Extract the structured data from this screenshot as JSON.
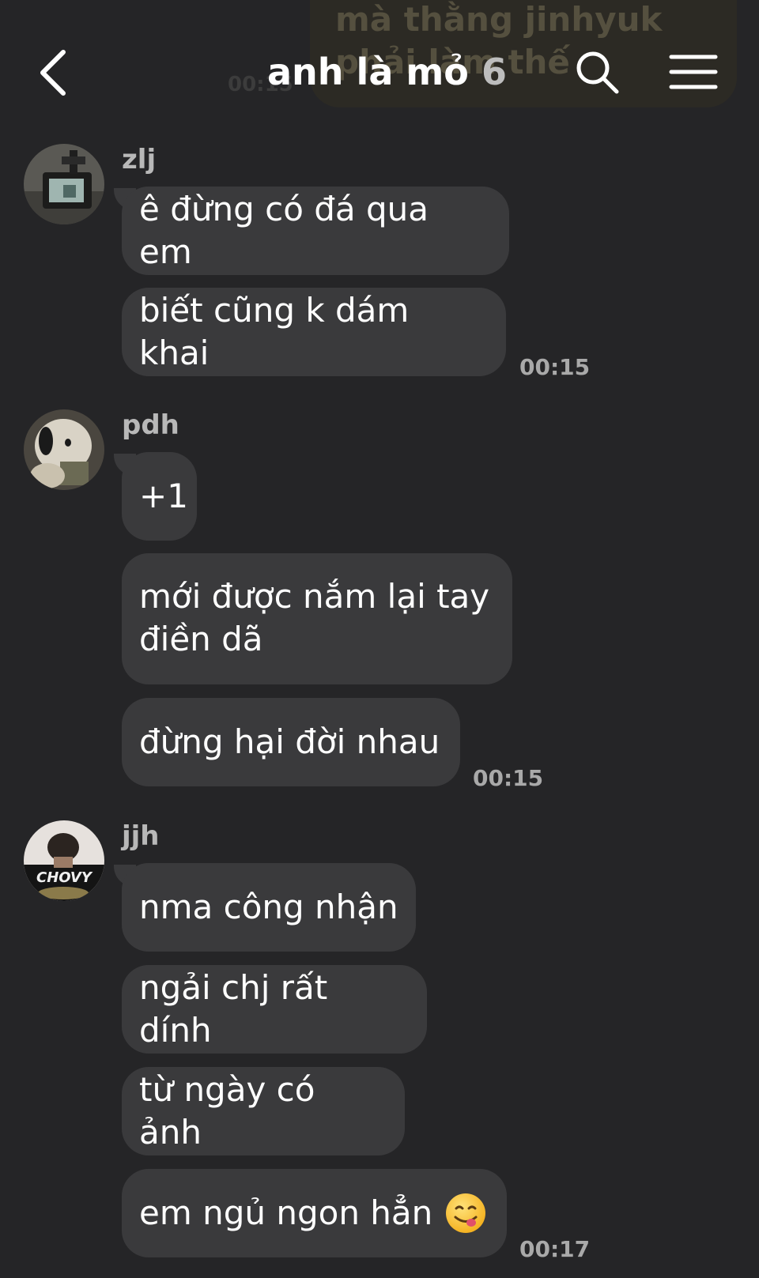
{
  "header": {
    "title": "anh là mỏ",
    "member_count": "6",
    "back_icon": "chevron-left-icon",
    "search_icon": "search-icon",
    "menu_icon": "hamburger-menu-icon"
  },
  "background_preview": {
    "text": "mà thằng jinhyuk phải làm thế",
    "time": "00:15"
  },
  "messages": [
    {
      "sender": "zlj",
      "bubbles": [
        "ê đừng có đá qua em",
        "biết cũng k dám khai"
      ],
      "time": "00:15"
    },
    {
      "sender": "pdh",
      "bubbles": [
        "+1",
        "mới được nắm lại tay điền dã",
        "đừng hại đời nhau"
      ],
      "time": "00:15"
    },
    {
      "sender": "jjh",
      "avatar_text": "CHOVY",
      "bubbles": [
        "nma công nhận",
        "ngải chj rất dính",
        "từ ngày có ảnh",
        "em ngủ ngon hẳn"
      ],
      "emoji": "yummy-face-emoji",
      "time": "00:17"
    }
  ],
  "colors": {
    "background": "#252527",
    "bubble": "#3a3a3c",
    "text": "#ffffff",
    "muted": "#a9a9a9"
  }
}
